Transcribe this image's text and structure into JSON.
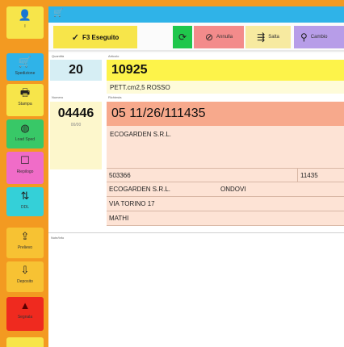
{
  "sidebar": {
    "items": [
      {
        "icon": "user-icon",
        "glyph": "👤",
        "label": "I",
        "bg": "#f7e54a"
      },
      {
        "icon": "cart-icon",
        "glyph": "🛒",
        "label": "Spedizione",
        "bg": "#2fb3e8"
      },
      {
        "icon": "printer-icon",
        "glyph": "🖶",
        "label": "Stampa",
        "bg": "#f7e54a"
      },
      {
        "icon": "globe-icon",
        "glyph": "◍",
        "label": "Load Sped",
        "bg": "#38c867"
      },
      {
        "icon": "box-icon",
        "glyph": "☐",
        "label": "Riepilogo",
        "bg": "#f06cc8"
      },
      {
        "icon": "sync-icon",
        "glyph": "⇅",
        "label": "DDL",
        "bg": "#34d0d8"
      },
      {
        "icon": "upload-icon",
        "glyph": "⇪",
        "label": "Prelievo",
        "bg": "#f7c233"
      },
      {
        "icon": "download-icon",
        "glyph": "⇩",
        "label": "Deposito",
        "bg": "#f7c233"
      },
      {
        "icon": "warning-icon",
        "glyph": "▲",
        "label": "Segnala",
        "bg": "#ef2a1f"
      }
    ]
  },
  "toolbar": {
    "cart_glyph": "🛒",
    "done_label": "F3 Eseguito",
    "done_glyph": "✓",
    "refresh_glyph": "⟳",
    "cancel_label": "Annulla",
    "cancel_glyph": "⊘",
    "split_label": "Salta",
    "split_glyph": "⇶",
    "search_label": "Cambio",
    "search_glyph": "⚲"
  },
  "order": {
    "qty_caption": "Quantità",
    "qty": "20",
    "code_caption": "Articolo",
    "code": "10925",
    "desc": "PETT.cm2,5 ROSSO",
    "num_caption": "Numero",
    "num": "04446",
    "num_sub": "00/00",
    "ref_caption": "Richiesta",
    "ref": "05 11/26/111435",
    "customer": "ECOGARDEN S.R.L.",
    "row1_a": "503366",
    "row1_b": "11435",
    "row2_a": "ECOGARDEN S.R.L.",
    "row2_b": "ONDOVI",
    "row3": "VIA TORINO 17",
    "row4": "MATHI",
    "notes_caption": "Note/Info"
  }
}
